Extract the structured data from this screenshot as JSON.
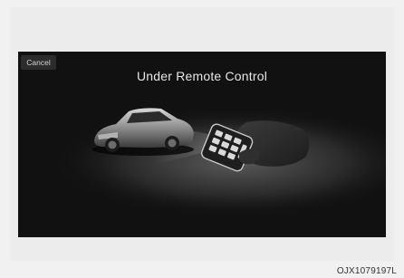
{
  "screen": {
    "cancel_label": "Cancel",
    "title": "Under Remote Control"
  },
  "illustration": {
    "subject": "car-with-remote-key"
  },
  "caption": "OJX1079197L"
}
